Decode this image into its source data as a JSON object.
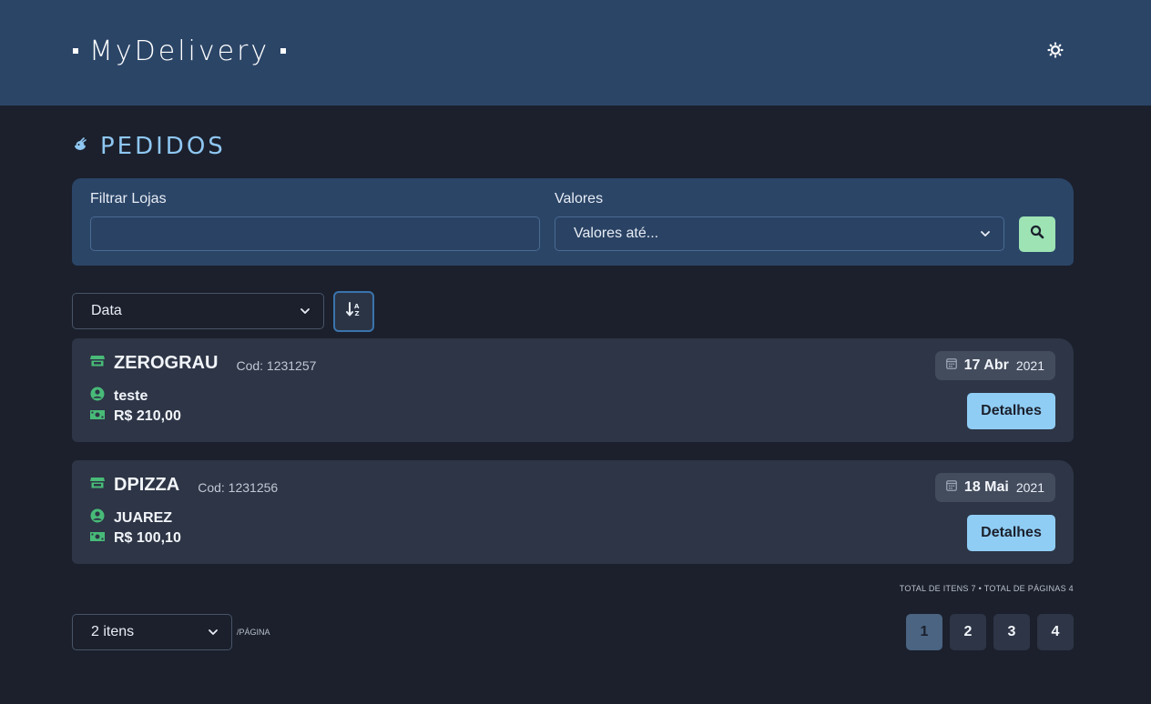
{
  "header": {
    "logo": "MyDelivery",
    "theme_icon": "sun-icon"
  },
  "page": {
    "title": "Pedidos",
    "title_icon": "food-icon"
  },
  "filters": {
    "store_label": "Filtrar Lojas",
    "store_value": "",
    "values_label": "Valores",
    "values_selected": "Valores até...",
    "search_icon": "search-icon"
  },
  "sort": {
    "selected": "Data",
    "direction_icon": "sort-amount-down-icon"
  },
  "orders": [
    {
      "store": "ZEROGRAU",
      "code": "Cod: 1231257",
      "customer": "teste",
      "value": "R$ 210,00",
      "date_main": "17 Abr",
      "date_year": "2021",
      "details": "Detalhes"
    },
    {
      "store": "DPIZZA",
      "code": "Cod: 1231256",
      "customer": "JUAREZ",
      "value": "R$ 100,10",
      "date_main": "18 Mai",
      "date_year": "2021",
      "details": "Detalhes"
    }
  ],
  "footer": {
    "totals": "TOTAL DE ITENS 7 • TOTAL DE PÁGINAS 4",
    "per_page": "2 itens",
    "per_page_label": "/PÁGINA",
    "pages": [
      "1",
      "2",
      "3",
      "4"
    ],
    "current_page": "1"
  },
  "colors": {
    "accent_green": "#48bb78",
    "accent_blue": "#90cdf4",
    "header_bg": "#2b4567"
  }
}
